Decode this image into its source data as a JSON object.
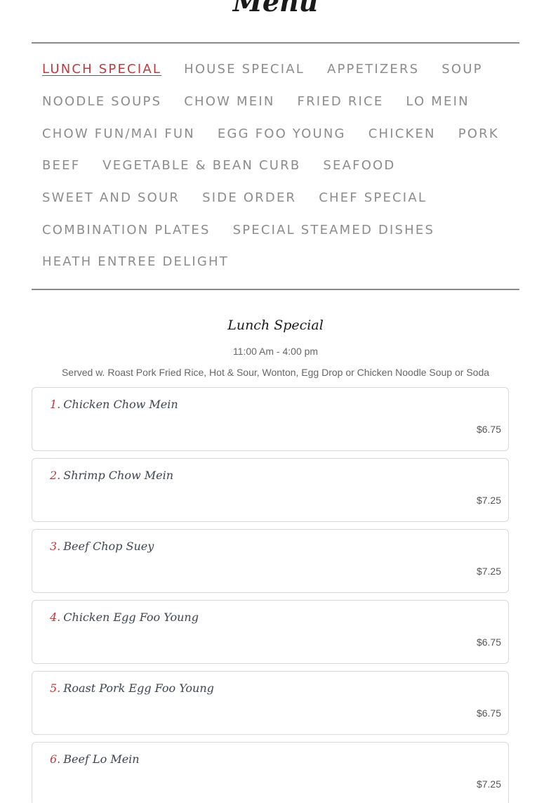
{
  "page": {
    "title": "Menu"
  },
  "nav": {
    "rows": [
      [
        "LUNCH SPECIAL",
        "HOUSE SPECIAL",
        "APPETIZERS",
        "SOUP"
      ],
      [
        "NOODLE SOUPS",
        "CHOW MEIN",
        "FRIED RICE",
        "LO MEIN"
      ],
      [
        "CHOW FUN/MAI FUN",
        "EGG FOO YOUNG",
        "CHICKEN",
        "PORK"
      ],
      [
        "BEEF",
        "VEGETABLE & BEAN CURB",
        "SEAFOOD"
      ],
      [
        "SWEET AND SOUR",
        "SIDE ORDER",
        "CHEF SPECIAL"
      ],
      [
        "COMBINATION PLATES",
        "SPECIAL STEAMED DISHES"
      ],
      [
        "HEATH ENTREE DELIGHT"
      ]
    ],
    "active": "LUNCH SPECIAL"
  },
  "section": {
    "title": "Lunch Special",
    "hours": "11:00 Am - 4:00 pm",
    "note": "Served w. Roast Pork Fried Rice, Hot & Sour, Wonton, Egg Drop or Chicken Noodle Soup or Soda"
  },
  "items": [
    {
      "num": "1.",
      "name": "Chicken Chow Mein",
      "price": "$6.75"
    },
    {
      "num": "2.",
      "name": "Shrimp Chow Mein",
      "price": "$7.25"
    },
    {
      "num": "3.",
      "name": "Beef Chop Suey",
      "price": "$7.25"
    },
    {
      "num": "4.",
      "name": "Chicken Egg Foo Young",
      "price": "$6.75"
    },
    {
      "num": "5.",
      "name": "Roast Pork Egg Foo Young",
      "price": "$6.75"
    },
    {
      "num": "6.",
      "name": "Beef Lo Mein",
      "price": "$7.25"
    }
  ],
  "colors": {
    "accent": "#c0393b",
    "nav_text": "#8c8c8c",
    "rule": "#8a8a8a",
    "item_text": "#3d4350"
  }
}
